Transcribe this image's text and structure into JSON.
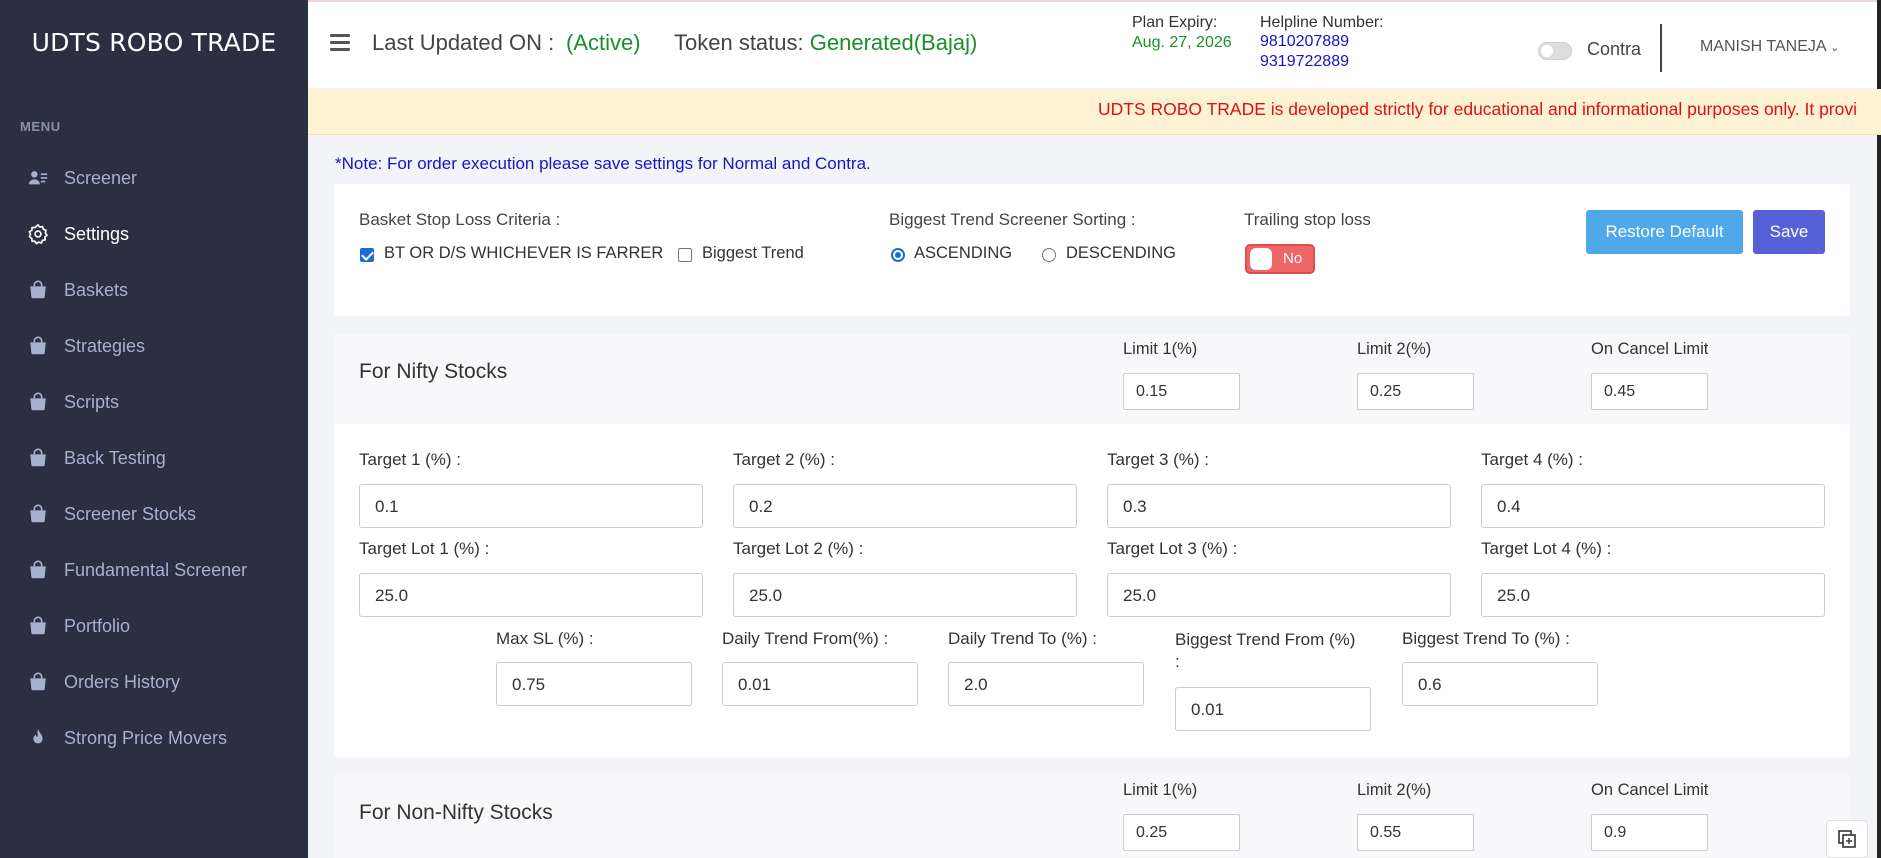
{
  "app": {
    "brand": "UDTS ROBO TRADE",
    "menu_title": "MENU"
  },
  "sidebar": {
    "items": [
      {
        "label": "Screener",
        "icon": "user-list-icon"
      },
      {
        "label": "Settings",
        "icon": "gear-icon",
        "active": true
      },
      {
        "label": "Baskets",
        "icon": "bag-icon"
      },
      {
        "label": "Strategies",
        "icon": "bag-icon"
      },
      {
        "label": "Scripts",
        "icon": "bag-icon"
      },
      {
        "label": "Back Testing",
        "icon": "bag-icon"
      },
      {
        "label": "Screener Stocks",
        "icon": "bag-icon"
      },
      {
        "label": "Fundamental Screener",
        "icon": "bag-icon"
      },
      {
        "label": "Portfolio",
        "icon": "bag-icon"
      },
      {
        "label": "Orders History",
        "icon": "bag-icon"
      },
      {
        "label": "Strong Price Movers",
        "icon": "fire-icon"
      }
    ]
  },
  "header": {
    "last_updated_label": "Last Updated ON :",
    "status": "(Active)",
    "token_label": "Token status:",
    "token_value": "Generated(Bajaj)",
    "plan_expiry_label": "Plan Expiry:",
    "plan_expiry_value": "Aug. 27, 2026",
    "helpline_label": "Helpline Number:",
    "helpline_1": "9810207889",
    "helpline_2": "9319722889",
    "contra_label": "Contra",
    "contra_on": false,
    "user_name": "MANISH TANEJA",
    "colors": {
      "active": "#1a8f2a",
      "phone": "#1515c8"
    }
  },
  "banner": {
    "text": "UDTS ROBO TRADE is developed strictly for educational and informational purposes only. It provi"
  },
  "note": "*Note: For order execution please save settings for Normal and Contra.",
  "general": {
    "basket_sl_label": "Basket Stop Loss Criteria :",
    "opt_bt_ds": "BT OR D/S WHICHEVER IS FARRER",
    "opt_bt_ds_checked": true,
    "opt_biggest": "Biggest Trend",
    "opt_biggest_checked": false,
    "sorting_label": "Biggest Trend Screener Sorting :",
    "asc": "ASCENDING",
    "desc": "DESCENDING",
    "sorting_selected": "ASCENDING",
    "tsl_label": "Trailing stop loss",
    "tsl_value": "No",
    "restore_label": "Restore Default",
    "save_label": "Save"
  },
  "nifty": {
    "title": "For Nifty Stocks",
    "limit1_label": "Limit 1(%)",
    "limit1": "0.15",
    "limit2_label": "Limit 2(%)",
    "limit2": "0.25",
    "cancel_label": "On Cancel Limit",
    "cancel": "0.45",
    "t1_label": "Target 1 (%) :",
    "t1": "0.1",
    "t2_label": "Target 2 (%) :",
    "t2": "0.2",
    "t3_label": "Target 3 (%) :",
    "t3": "0.3",
    "t4_label": "Target 4 (%) :",
    "t4": "0.4",
    "tl1_label": "Target Lot 1 (%) :",
    "tl1": "25.0",
    "tl2_label": "Target Lot 2 (%) :",
    "tl2": "25.0",
    "tl3_label": "Target Lot 3 (%) :",
    "tl3": "25.0",
    "tl4_label": "Target Lot 4 (%) :",
    "tl4": "25.0",
    "maxsl_label": "Max SL (%) :",
    "maxsl": "0.75",
    "dtf_label": "Daily Trend From(%) :",
    "dtf": "0.01",
    "dtt_label": "Daily Trend To (%) :",
    "dtt": "2.0",
    "btf_label_1": "Biggest Trend From (%)",
    "btf_label_2": ":",
    "btf": "0.01",
    "btt_label": "Biggest Trend To (%) :",
    "btt": "0.6"
  },
  "nonnifty": {
    "title": "For Non-Nifty Stocks",
    "limit1_label": "Limit 1(%)",
    "limit1": "0.25",
    "limit2_label": "Limit 2(%)",
    "limit2": "0.55",
    "cancel_label": "On Cancel Limit",
    "cancel": "0.9"
  }
}
